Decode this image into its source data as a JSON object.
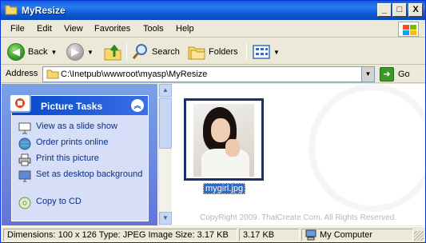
{
  "window": {
    "title": "MyResize",
    "controls": {
      "minimize": "_",
      "maximize": "□",
      "close": "X"
    }
  },
  "menu": [
    "File",
    "Edit",
    "View",
    "Favorites",
    "Tools",
    "Help"
  ],
  "toolbar": {
    "back_label": "Back",
    "search_label": "Search",
    "folders_label": "Folders"
  },
  "address": {
    "label": "Address",
    "path": "C:\\Inetpub\\wwwroot\\myasp\\MyResize",
    "go_label": "Go"
  },
  "tasks": {
    "title": "Picture Tasks",
    "items": [
      {
        "label": "View as a slide show",
        "icon": "slideshow-icon"
      },
      {
        "label": "Order prints online",
        "icon": "globe-icon"
      },
      {
        "label": "Print this picture",
        "icon": "printer-icon"
      },
      {
        "label": "Set as desktop background",
        "icon": "desktop-icon"
      },
      {
        "label": "Copy to CD",
        "icon": "cd-icon"
      }
    ]
  },
  "files": [
    {
      "name": "mygirl.jpg",
      "selected": true
    }
  ],
  "watermark_text": "CopyRight 2009. ThaiCreate.Com. All Rights Reserved.",
  "status": {
    "details": "Dimensions: 100 x 126 Type: JPEG Image Size: 3.17 KB",
    "size": "3.17 KB",
    "zone": "My Computer"
  },
  "colors": {
    "titlebar": "#0a5fd8",
    "task_pane": "#7aa1e6",
    "selection": "#316ac5"
  }
}
